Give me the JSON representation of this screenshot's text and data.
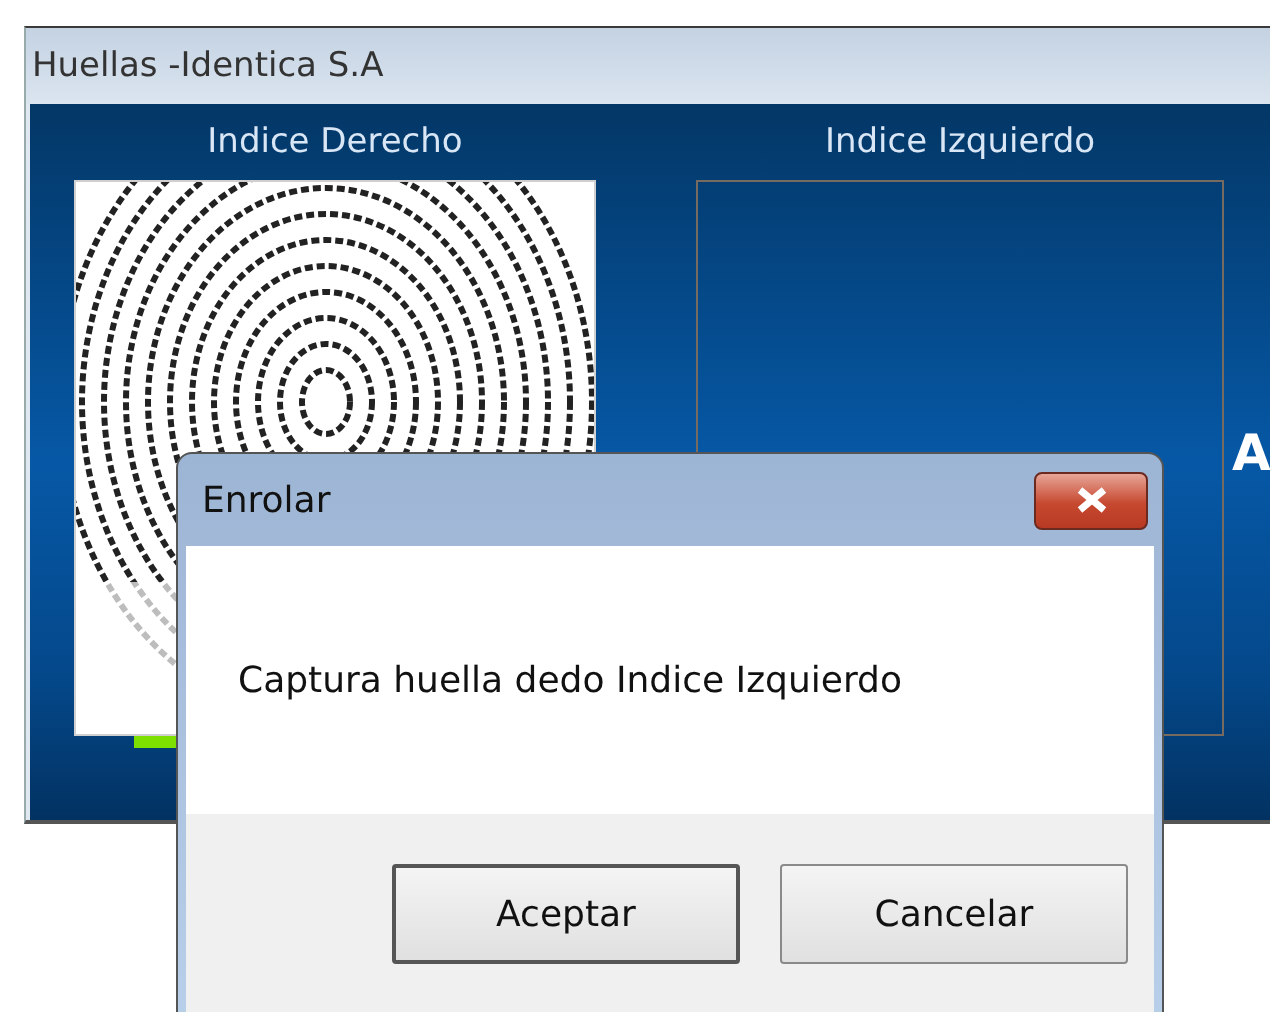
{
  "window": {
    "title": "Huellas -Identica S.A"
  },
  "fingers": [
    {
      "label": "Indice Derecho",
      "captured": true
    },
    {
      "label": "Indice Izquierdo",
      "captured": false
    }
  ],
  "logo": {
    "text": "A"
  },
  "dialog": {
    "title": "Enrolar",
    "message": "Captura huella dedo Indice Izquierdo",
    "buttons": [
      {
        "label": "Aceptar",
        "default": true
      },
      {
        "label": "Cancelar",
        "default": false
      }
    ]
  }
}
